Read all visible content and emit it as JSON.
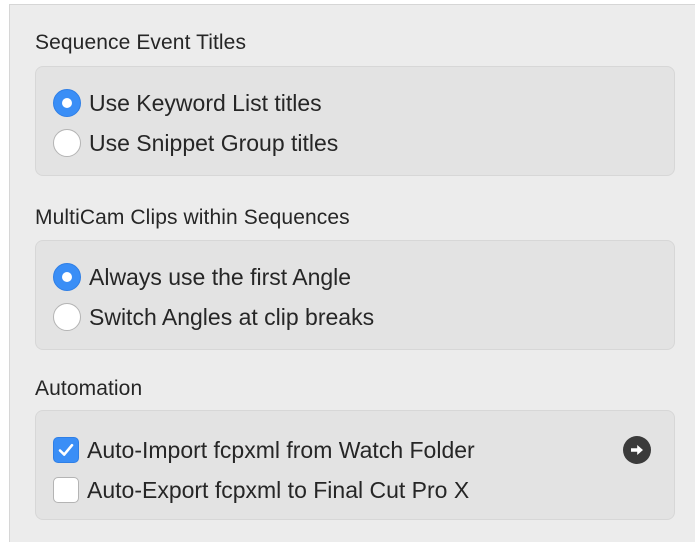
{
  "sections": [
    {
      "title": "Sequence Event Titles",
      "options": [
        {
          "label": "Use Keyword List titles",
          "selected": true
        },
        {
          "label": "Use Snippet Group titles",
          "selected": false
        }
      ]
    },
    {
      "title": "MultiCam Clips within Sequences",
      "options": [
        {
          "label": "Always use the first Angle",
          "selected": true
        },
        {
          "label": "Switch Angles at clip breaks",
          "selected": false
        }
      ]
    },
    {
      "title": "Automation",
      "options": [
        {
          "label": "Auto-Import fcpxml from Watch Folder",
          "checked": true
        },
        {
          "label": "Auto-Export fcpxml to Final Cut Pro X",
          "checked": false
        }
      ],
      "reveal_button_icon": "arrow-right-circle-icon"
    }
  ],
  "colors": {
    "accent": "#3a8ef6",
    "panel_background": "#ececec",
    "group_background": "#e3e3e3",
    "text": "#262626"
  }
}
